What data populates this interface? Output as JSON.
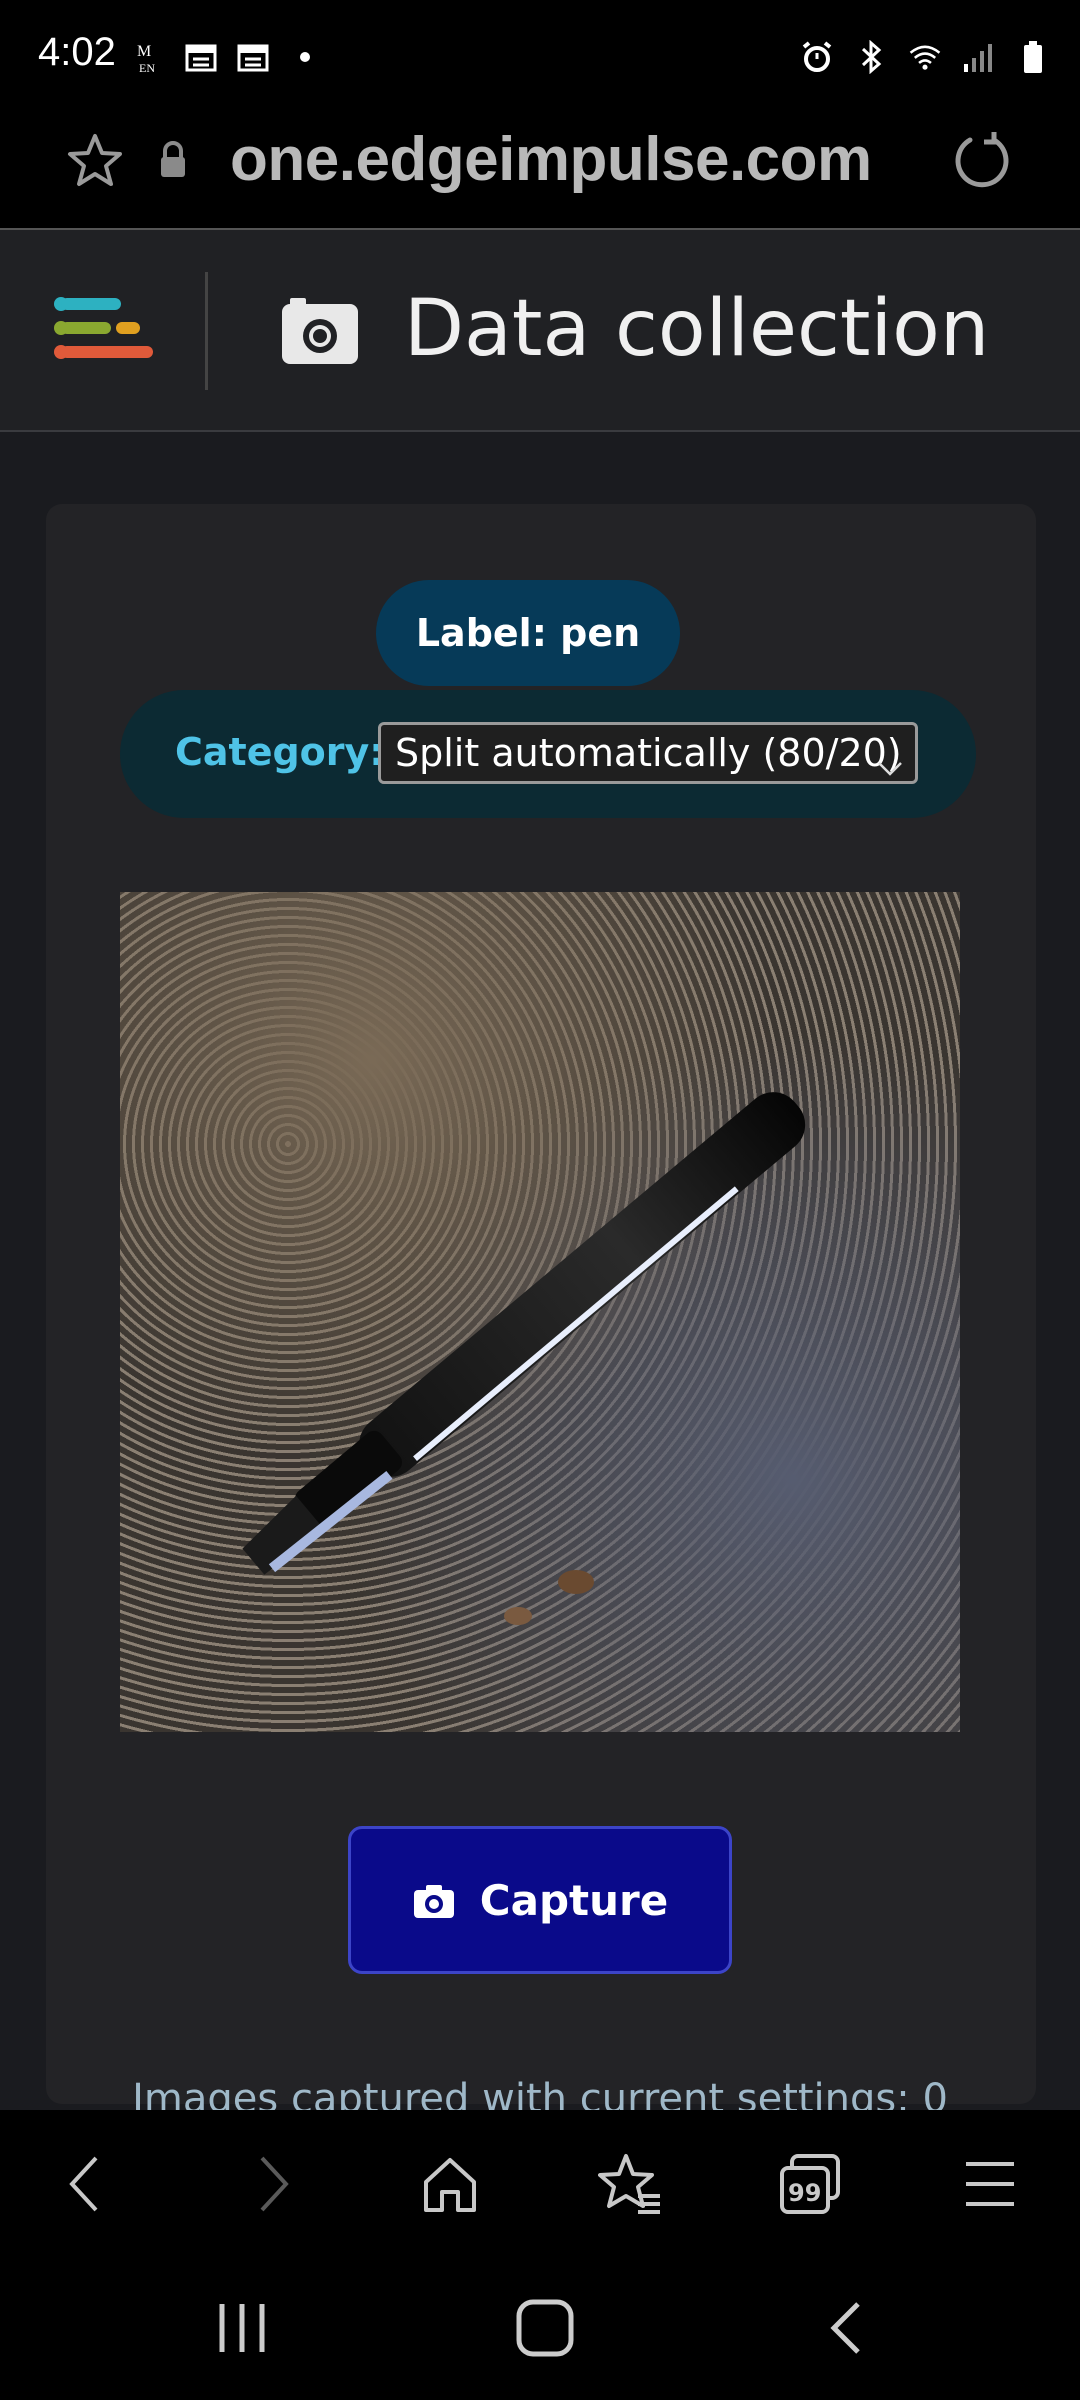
{
  "status_bar": {
    "time": "4:02",
    "left_icons": [
      "mail-icon",
      "calendar-icon",
      "calendar-icon",
      "dot-icon"
    ],
    "right_icons": [
      "alarm-icon",
      "bluetooth-icon",
      "wifi-icon",
      "signal-icon",
      "battery-icon"
    ]
  },
  "url_bar": {
    "url": "one.edgeimpulse.com"
  },
  "header": {
    "title": "Data collection"
  },
  "collection": {
    "label": "Label: pen",
    "category_label": "Category:",
    "category_value": "Split automatically (80/20)",
    "capture_label": "Capture",
    "images_captured_text": "Images captured with current settings: 0"
  },
  "colors": {
    "accent_cyan": "#4fc3e7",
    "label_pill": "#063a58",
    "capture_button": "#0a0a8a"
  }
}
